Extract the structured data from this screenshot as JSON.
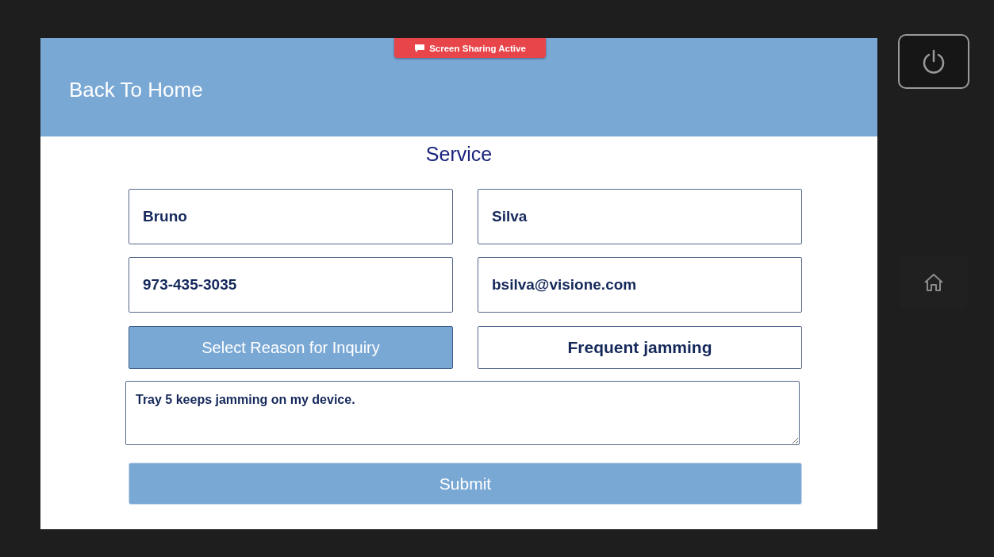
{
  "header": {
    "back_label": "Back To Home"
  },
  "badge": {
    "label": "Screen Sharing Active"
  },
  "title": "Service",
  "fields": [
    {
      "value": "Bruno"
    },
    {
      "value": "Silva"
    },
    {
      "value": "973-435-3035"
    },
    {
      "value": "bsilva@visione.com"
    }
  ],
  "reason_button": "Select Reason for Inquiry",
  "reason_value": "Frequent jamming",
  "message": "Tray 5 keeps jamming on my device.",
  "submit": "Submit"
}
